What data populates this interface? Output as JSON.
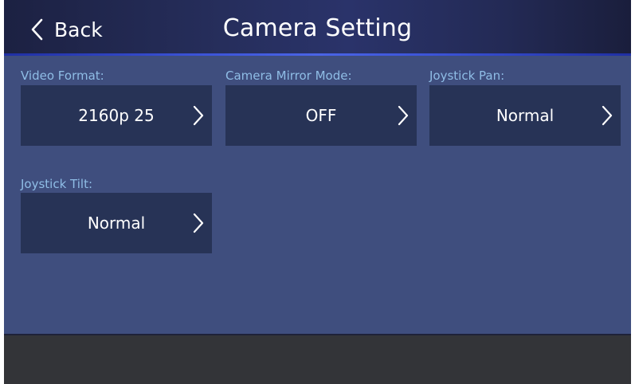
{
  "header": {
    "back_label": "Back",
    "title": "Camera Setting"
  },
  "settings": [
    {
      "label": "Video Format:",
      "value": "2160p 25"
    },
    {
      "label": "Camera Mirror Mode:",
      "value": "OFF"
    },
    {
      "label": "Joystick Pan:",
      "value": "Normal"
    },
    {
      "label": "Joystick Tilt:",
      "value": "Normal"
    }
  ],
  "icons": {
    "back": "chevron-left-icon",
    "open": "chevron-right-icon"
  },
  "colors": {
    "header_bg": "#262e5c",
    "accent_line": "#3a52d6",
    "content_bg": "#3f4e7e",
    "tile_bg": "#273356",
    "label_text": "#8fbde6",
    "footer_bg": "#333438"
  }
}
